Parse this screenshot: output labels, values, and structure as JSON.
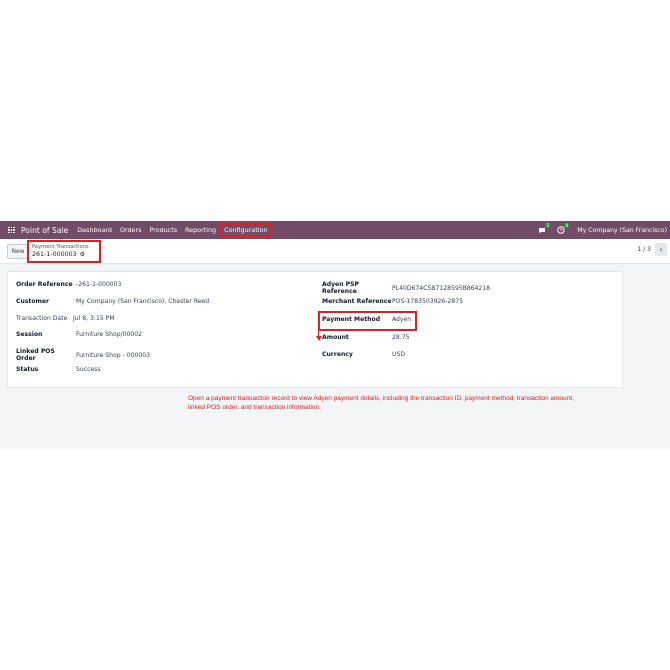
{
  "navbar": {
    "brand": "Point of Sale",
    "items": [
      "Dashboard",
      "Orders",
      "Products",
      "Reporting",
      "Configuration"
    ],
    "discuss_badge": "7",
    "activity_badge": "4",
    "company": "My Company (San Francisco)"
  },
  "control_panel": {
    "new_label": "New",
    "breadcrumb_parent": "Payment Transactions",
    "breadcrumb_current": "261-1-000003",
    "pager": "1 / 3",
    "prev_label": "‹"
  },
  "form": {
    "left": [
      {
        "label": "Order Reference",
        "value": "-261-1-000003"
      },
      {
        "label": "Customer",
        "value": "My Company (San Francisco), Chester Reed"
      },
      {
        "label": "Transaction Date",
        "value": "Jul 8, 3:15 PM"
      },
      {
        "label": "Session",
        "value": "Furniture Shop/00002"
      },
      {
        "label": "Linked POS Order",
        "value": "Furniture Shop - 000003"
      },
      {
        "label": "Status",
        "value": "Success"
      }
    ],
    "right": [
      {
        "label": "Adyen PSP Reference",
        "value": "PL40D674C5B7128595B864218"
      },
      {
        "label": "Merchant Reference",
        "value": "POS-1783503926-2875"
      },
      {
        "label": "Payment Method",
        "value": "Adyen"
      },
      {
        "label": "Amount",
        "value": "28.75"
      },
      {
        "label": "Currency",
        "value": "USD"
      }
    ]
  },
  "annotation": "Open a payment transaction record to view Adyen payment details, including the transaction ID, payment method, transaction amount, linked POS order, and transaction information.",
  "colors": {
    "navbar": "#714b67",
    "highlight": "#e02020",
    "badge": "#28a745"
  },
  "icons": [
    "apps-grid-icon",
    "chat-icon",
    "clock-icon",
    "gear-icon",
    "chevron-left-icon",
    "arrow-down-icon"
  ]
}
